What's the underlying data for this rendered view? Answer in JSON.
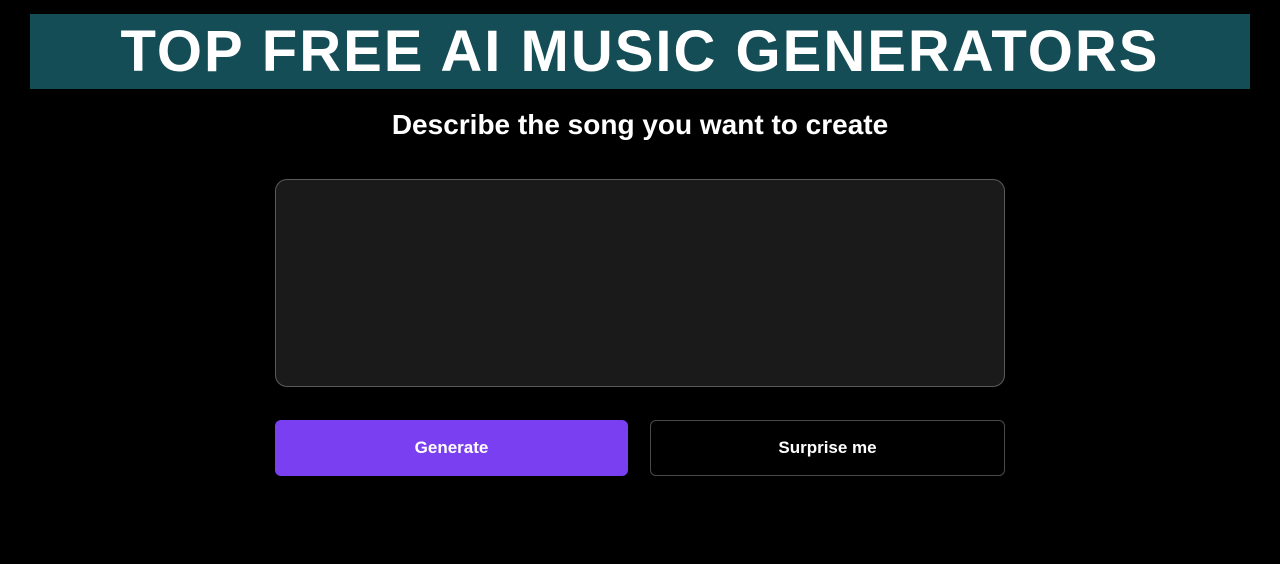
{
  "banner": {
    "title": "TOP FREE AI MUSIC GENERATORS"
  },
  "main": {
    "heading": "Describe the song you want to create",
    "prompt": {
      "value": "",
      "placeholder": ""
    },
    "buttons": {
      "generate_label": "Generate",
      "surprise_label": "Surprise me"
    }
  },
  "colors": {
    "banner_bg": "#154d56",
    "primary_button": "#7b3ff2",
    "background": "#000000",
    "textarea_bg": "#1a1a1a"
  }
}
